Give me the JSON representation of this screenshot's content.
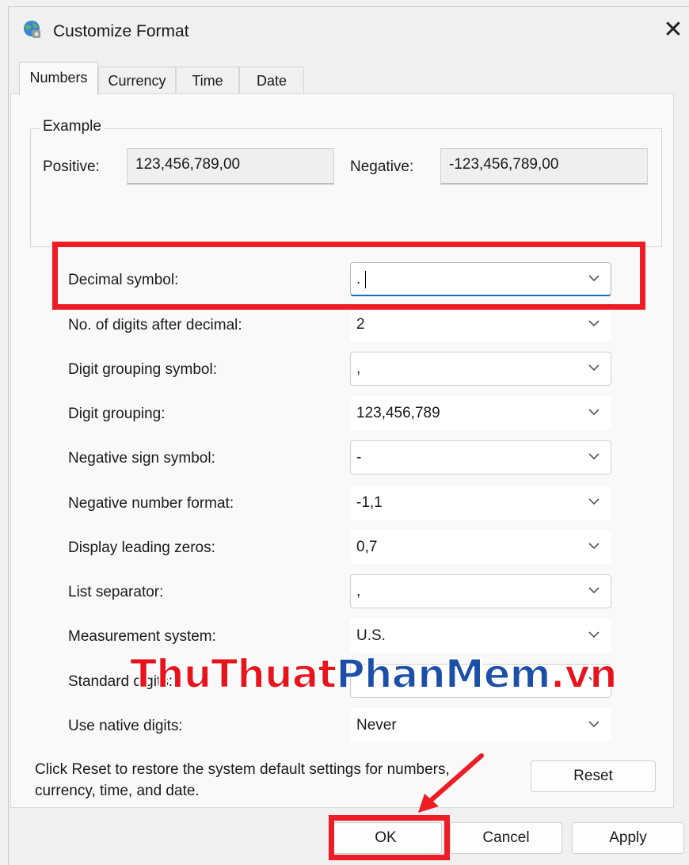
{
  "window": {
    "title": "Customize Format",
    "icon": "globe-settings-icon",
    "close": "✕"
  },
  "tabs": [
    {
      "label": "Numbers",
      "active": true
    },
    {
      "label": "Currency",
      "active": false
    },
    {
      "label": "Time",
      "active": false
    },
    {
      "label": "Date",
      "active": false
    }
  ],
  "example": {
    "title": "Example",
    "positive_label": "Positive:",
    "positive_value": "123,456,789,00",
    "negative_label": "Negative:",
    "negative_value": "-123,456,789,00"
  },
  "settings": [
    {
      "label": "Decimal symbol:",
      "value": "."
    },
    {
      "label": "No. of digits after decimal:",
      "value": "2"
    },
    {
      "label": "Digit grouping symbol:",
      "value": ","
    },
    {
      "label": "Digit grouping:",
      "value": "123,456,789"
    },
    {
      "label": "Negative sign symbol:",
      "value": "-"
    },
    {
      "label": "Negative number format:",
      "value": "-1,1"
    },
    {
      "label": "Display leading zeros:",
      "value": "0,7"
    },
    {
      "label": "List separator:",
      "value": ","
    },
    {
      "label": "Measurement system:",
      "value": "U.S."
    },
    {
      "label": "Standard digits:",
      "value": ""
    },
    {
      "label": "Use native digits:",
      "value": "Never"
    }
  ],
  "footer": {
    "note": "Click Reset to restore the system default settings for numbers, currency, time, and date.",
    "reset": "Reset",
    "ok": "OK",
    "cancel": "Cancel",
    "apply": "Apply"
  },
  "watermark": {
    "part1": "ThuThuat",
    "part2": "PhanMem",
    "part3": ".vn"
  },
  "colors": {
    "highlight": "#ee1c24",
    "arrow": "#ee1c24",
    "focus": "#1f6fb5"
  }
}
